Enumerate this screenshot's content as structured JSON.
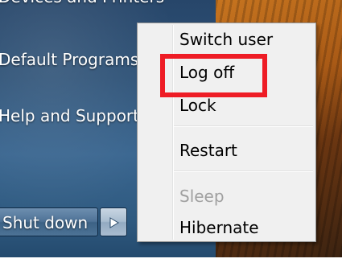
{
  "start_menu_right": {
    "items": [
      {
        "label": "Devices and Printers"
      },
      {
        "label": "Default Programs"
      },
      {
        "label": "Help and Support"
      }
    ],
    "shutdown_label": "Shut down"
  },
  "power_menu": {
    "items": [
      {
        "label": "Switch user",
        "enabled": true
      },
      {
        "label": "Log off",
        "enabled": true,
        "highlighted": true
      },
      {
        "label": "Lock",
        "enabled": true
      },
      {
        "label": "Restart",
        "enabled": true
      },
      {
        "label": "Sleep",
        "enabled": false
      },
      {
        "label": "Hibernate",
        "enabled": true
      }
    ]
  },
  "colors": {
    "highlight_border": "#ee1c25",
    "menu_background": "#f0f0f0",
    "start_pane": "#2e5277",
    "disabled_text": "#a0a0a0"
  },
  "icons": {
    "shutdown_options": "triangle-right-icon"
  }
}
